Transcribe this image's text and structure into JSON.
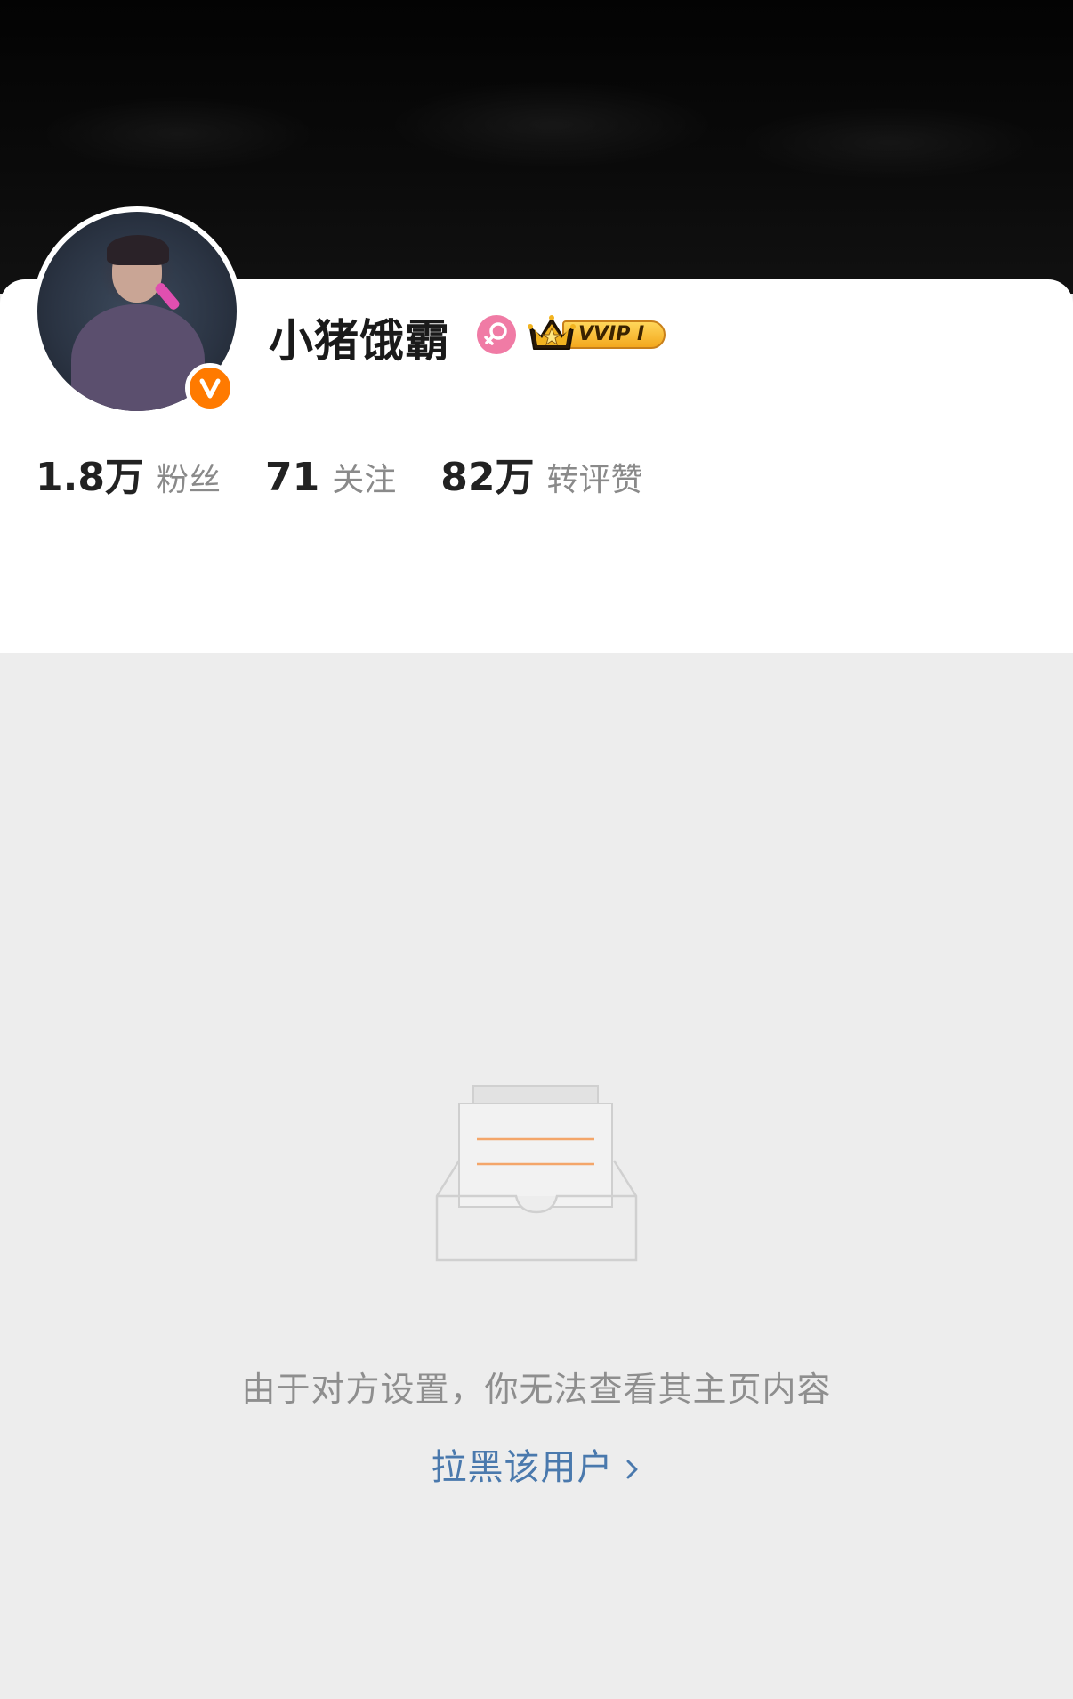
{
  "profile": {
    "username": "小猪饿霸",
    "gender_icon": "female-icon",
    "membership_label": "VVIP I",
    "verified_icon": "verified-v-icon"
  },
  "stats": [
    {
      "value": "1.8万",
      "label": "粉丝"
    },
    {
      "value": "71",
      "label": "关注"
    },
    {
      "value": "82万",
      "label": "转评赞"
    }
  ],
  "restricted": {
    "message": "由于对方设置，你无法查看其主页内容",
    "block_link_label": "拉黑该用户",
    "illustration_icon": "empty-inbox-icon"
  },
  "colors": {
    "background": "#ededed",
    "card": "#ffffff",
    "link": "#4a79ad",
    "verified": "#ff7a00",
    "gender": "#f07ba5",
    "vvip_gold": "#f3b73a"
  }
}
